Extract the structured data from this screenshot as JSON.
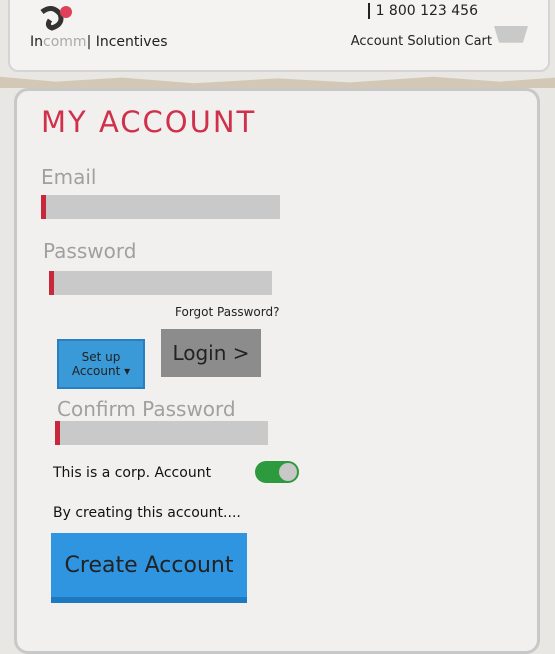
{
  "header": {
    "phone": "1 800 123 456",
    "brand_prefix": "In",
    "brand_muted": "comm",
    "brand_suffix": "| Incentives",
    "nav": [
      "Account",
      "Solution",
      "Cart"
    ]
  },
  "account": {
    "title": "MY ACCOUNT",
    "email_label": "Email",
    "email_value": "",
    "password_label": "Password",
    "password_value": "",
    "forgot_password": "Forgot Password?",
    "setup_button": "Set up Account ▾",
    "login_button": "Login >",
    "confirm_label": "Confirm Password",
    "confirm_value": "",
    "corp_label": "This is a corp. Account",
    "corp_toggle_on": true,
    "terms_text": "By creating this account....",
    "create_button": "Create Account"
  },
  "colors": {
    "accent_red": "#d0304a",
    "button_blue": "#2f95e0",
    "toggle_green": "#2e9a3e"
  }
}
